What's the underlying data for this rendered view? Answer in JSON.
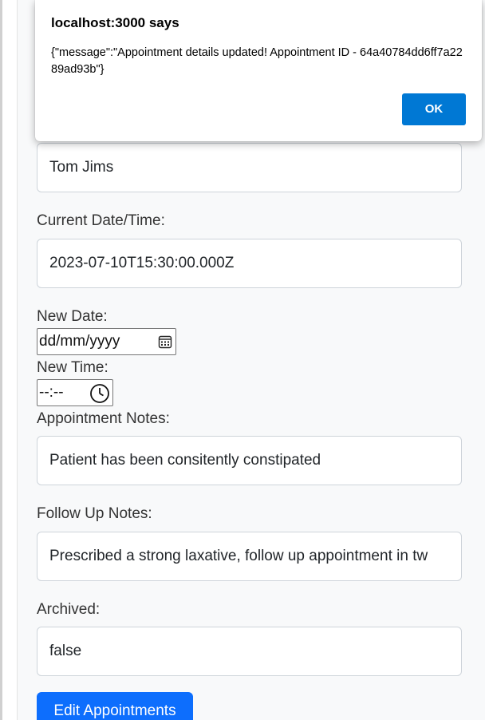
{
  "form": {
    "patient_name_value": "Tom Jims",
    "current_datetime_label": "Current Date/Time:",
    "current_datetime_value": "2023-07-10T15:30:00.000Z",
    "new_date_label": "New Date:",
    "new_date_placeholder": "dd/mm/yyyy",
    "new_time_label": "New Time:",
    "new_time_placeholder": "--:--",
    "appointment_notes_label": "Appointment Notes:",
    "appointment_notes_value": "Patient has been consitently constipated",
    "follow_up_notes_label": "Follow Up Notes:",
    "follow_up_notes_value": "Prescribed a strong laxative, follow up appointment in tw",
    "archived_label": "Archived:",
    "archived_value": "false",
    "submit_label": "Edit Appointments"
  },
  "alert": {
    "title": "localhost:3000 says",
    "message": "{\"message\":\"Appointment details updated! Appointment ID - 64a40784dd6ff7a2289ad93b\"}",
    "ok_label": "OK"
  },
  "colors": {
    "primary_button": "#0d6efd",
    "dialog_ok": "#0078d4",
    "panel_background": "#f8f9fa"
  },
  "icons": {
    "date_picker": "calendar-icon",
    "time_picker": "clock-icon"
  }
}
